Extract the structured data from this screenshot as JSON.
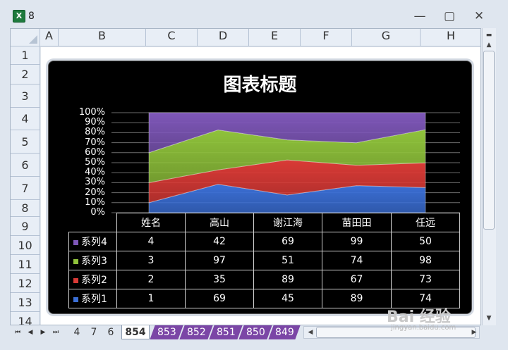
{
  "window": {
    "title": "8",
    "buttons": {
      "minimize": "—",
      "restore": "▢",
      "close": "✕"
    }
  },
  "sheet": {
    "columns": [
      "A",
      "B",
      "C",
      "D",
      "E",
      "F",
      "G",
      "H"
    ],
    "rows": [
      "1",
      "2",
      "3",
      "4",
      "5",
      "6",
      "7",
      "8",
      "9",
      "10",
      "11",
      "12",
      "13",
      "14"
    ]
  },
  "chart_data": {
    "type": "area",
    "stacking": "percent",
    "title": "图表标题",
    "categories": [
      "姓名",
      "高山",
      "谢江海",
      "苗田田",
      "任远"
    ],
    "series": [
      {
        "name": "系列1",
        "values": [
          1,
          69,
          45,
          89,
          74
        ],
        "color": "#3b6fd6"
      },
      {
        "name": "系列2",
        "values": [
          2,
          35,
          89,
          67,
          73
        ],
        "color": "#d93a36"
      },
      {
        "name": "系列3",
        "values": [
          3,
          97,
          51,
          74,
          98
        ],
        "color": "#8fc23b"
      },
      {
        "name": "系列4",
        "values": [
          4,
          42,
          69,
          99,
          50
        ],
        "color": "#7e57b8"
      }
    ],
    "y_ticks": [
      "100%",
      "90%",
      "80%",
      "70%",
      "60%",
      "50%",
      "40%",
      "30%",
      "20%",
      "10%",
      "0%"
    ],
    "ylim": [
      0,
      1
    ],
    "grid": true,
    "data_table": true,
    "background": "#000000"
  },
  "sheet_tabs": {
    "nav": [
      "⏮",
      "◀",
      "▶",
      "⏭"
    ],
    "tabs": [
      "4",
      "7",
      "6",
      "854",
      "853",
      "852",
      "851",
      "850",
      "849"
    ],
    "active": "854"
  },
  "watermark": {
    "logo": "Bai 经验",
    "url": "jingyan.baidu.com"
  }
}
